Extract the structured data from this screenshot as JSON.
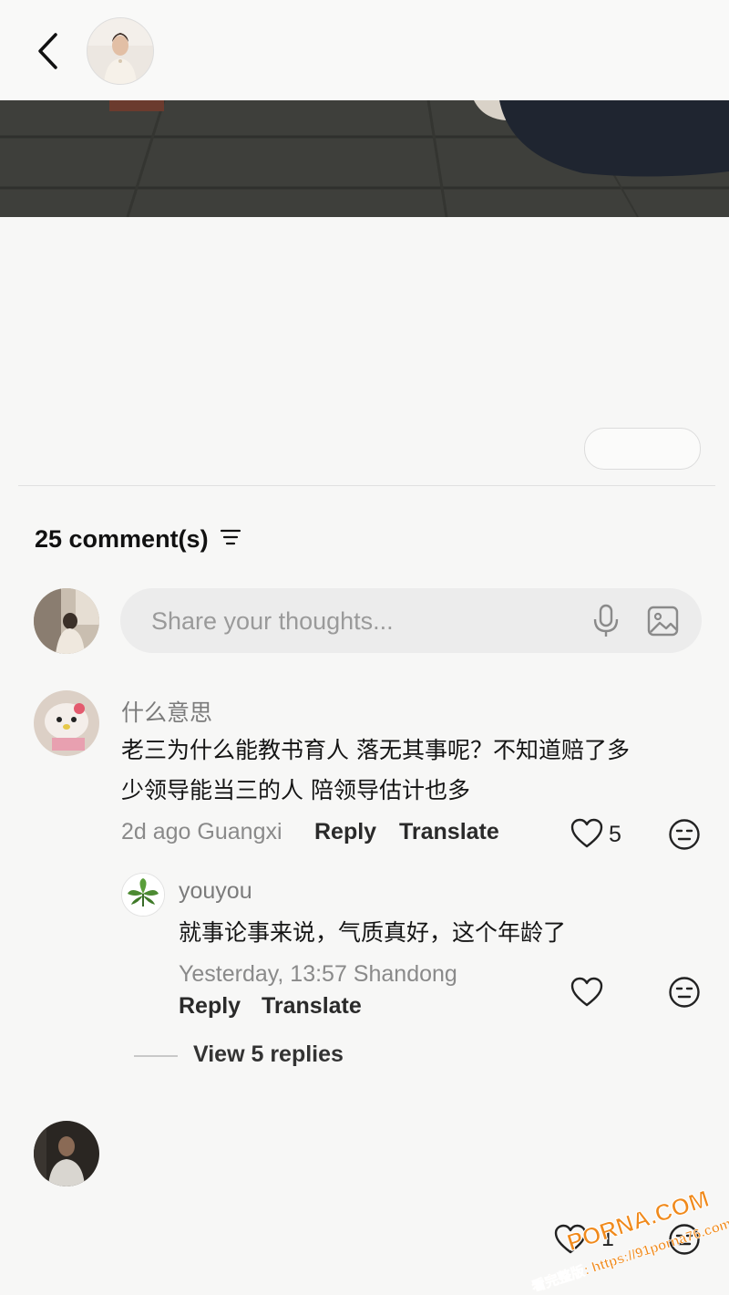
{
  "header": {
    "back_icon": "chevron-left-icon"
  },
  "post": {
    "empty_pill_label": ""
  },
  "comments_section": {
    "count_label": "25 comment(s)",
    "sort_icon": "sort-lines-icon"
  },
  "composer": {
    "placeholder": "Share your thoughts...",
    "value": "",
    "mic_icon": "microphone-icon",
    "image_icon": "image-icon"
  },
  "comments": [
    {
      "author": "什么意思",
      "text_line1": "老三为什么能教书育人 落无其事呢？不知道赔了多",
      "text_line2": "少领导能当三的人 陪领导估计也多",
      "meta": "2d ago Guangxi",
      "reply_label": "Reply",
      "translate_label": "Translate",
      "likes": "5",
      "reply": {
        "author": "youyou",
        "text": "就事论事来说，气质真好，这个年龄了",
        "meta": "Yesterday, 13:57 Shandong",
        "reply_label": "Reply",
        "translate_label": "Translate"
      },
      "view_replies_label": "View 5 replies"
    },
    {
      "likes": "1"
    }
  ],
  "watermark": {
    "brand": "PORNA.COM",
    "line2": "看完整版: https://91porna76.com"
  },
  "colors": {
    "background": "#f7f7f6",
    "composer_bg": "#ececec",
    "watermark_orange": "#f08a1c"
  }
}
